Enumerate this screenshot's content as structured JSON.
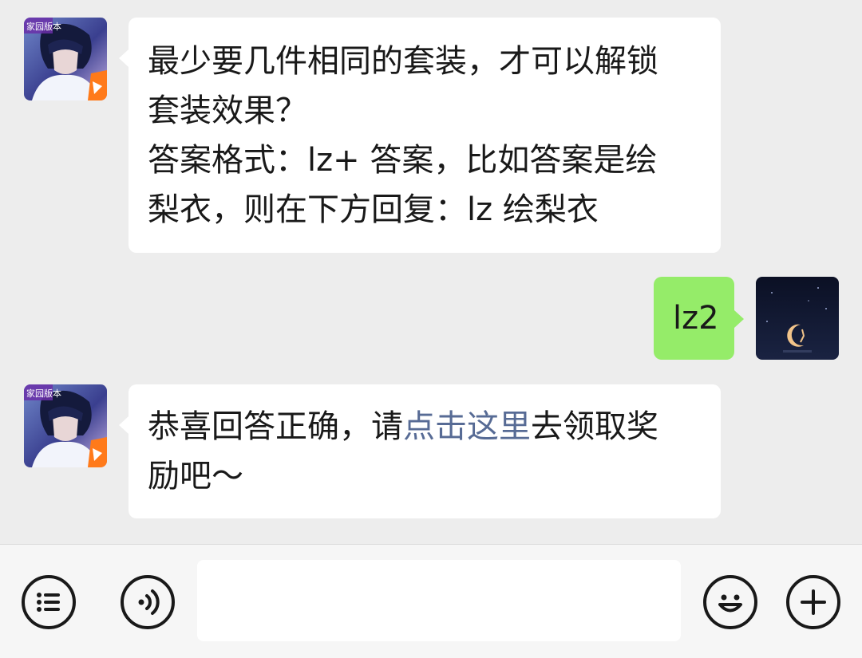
{
  "messages": [
    {
      "sender": "official-account",
      "lines": [
        "最少要几件相同的套装，才可以解锁",
        "套装效果？",
        "答案格式：lz+ 答案，比如答案是绘",
        "梨衣，则在下方回复：lz 绘梨衣"
      ]
    },
    {
      "sender": "me",
      "text": "lz2"
    },
    {
      "sender": "official-account",
      "line1_before": "恭喜回答正确，请",
      "line1_link": "点击这里",
      "line1_after": "去领取奖",
      "line2": "励吧～"
    }
  ],
  "avatars": {
    "official_badge_text": "家园版本"
  },
  "input_bar": {
    "menu_icon": "list-menu-icon",
    "voice_icon": "voice-icon",
    "input_value": "",
    "emoji_icon": "smiley-icon",
    "more_icon": "plus-icon"
  },
  "colors": {
    "chat_background": "#ededed",
    "incoming_bubble": "#ffffff",
    "outgoing_bubble": "#95ec69",
    "link": "#576b95"
  }
}
